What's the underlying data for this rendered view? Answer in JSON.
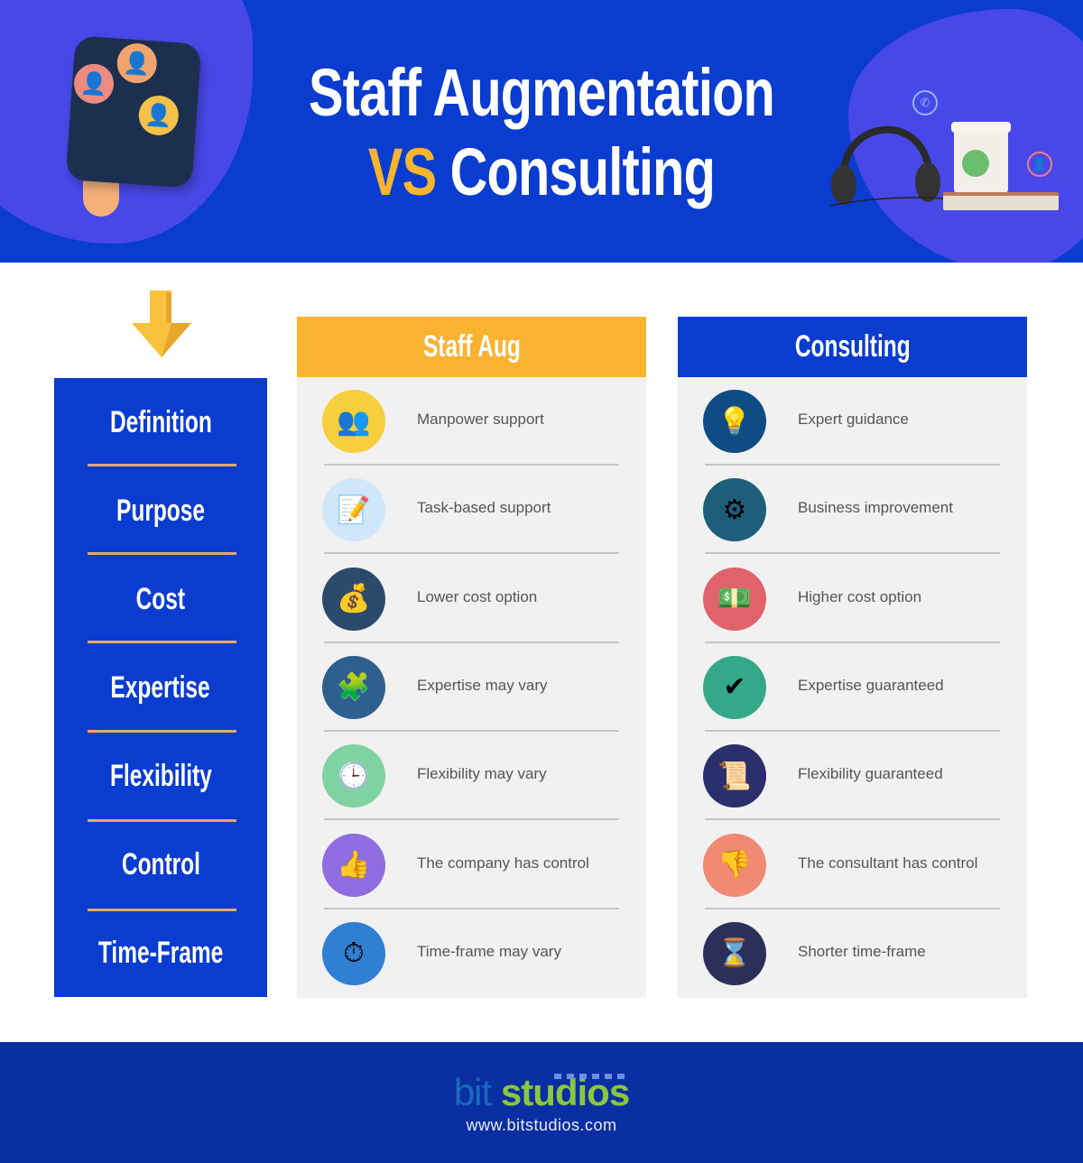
{
  "header": {
    "title_line1": "Staff Augmentation",
    "title_vs": "VS",
    "title_line2": "Consulting",
    "colors": {
      "background": "#0a3ccf",
      "blob": "#4848e8",
      "accent": "#f7b52e"
    }
  },
  "sidebar": {
    "items": [
      {
        "label": "Definition"
      },
      {
        "label": "Purpose"
      },
      {
        "label": "Cost"
      },
      {
        "label": "Expertise"
      },
      {
        "label": "Flexibility"
      },
      {
        "label": "Control"
      },
      {
        "label": "Time-Frame"
      }
    ]
  },
  "columns": [
    {
      "title": "Staff Aug",
      "color": "#f9b331",
      "rows": [
        {
          "icon": "team-people-icon",
          "glyph": "👥",
          "text": "Manpower support"
        },
        {
          "icon": "checklist-pencil-icon",
          "glyph": "📝",
          "text": "Task-based support"
        },
        {
          "icon": "coins-hand-icon",
          "glyph": "💰",
          "text": "Lower cost option"
        },
        {
          "icon": "head-puzzle-icon",
          "glyph": "🧩",
          "text": "Expertise may vary"
        },
        {
          "icon": "clock-icon",
          "glyph": "🕒",
          "text": "Flexibility may vary"
        },
        {
          "icon": "thumbs-up-icon",
          "glyph": "👍",
          "text": "The company has control"
        },
        {
          "icon": "pie-clock-icon",
          "glyph": "⏱",
          "text": "Time-frame may vary"
        }
      ]
    },
    {
      "title": "Consulting",
      "color": "#0a3ccf",
      "rows": [
        {
          "icon": "lightbulb-icon",
          "glyph": "💡",
          "text": "Expert guidance"
        },
        {
          "icon": "gears-icon",
          "glyph": "⚙",
          "text": "Business improvement"
        },
        {
          "icon": "money-hand-icon",
          "glyph": "💵",
          "text": "Higher cost option"
        },
        {
          "icon": "checkmark-icon",
          "glyph": "✔",
          "text": "Expertise guaranteed"
        },
        {
          "icon": "certificate-icon",
          "glyph": "📜",
          "text": "Flexibility guaranteed"
        },
        {
          "icon": "thumbs-down-icon",
          "glyph": "👎",
          "text": "The consultant has control"
        },
        {
          "icon": "hourglass-icon",
          "glyph": "⌛",
          "text": "Shorter time-frame"
        }
      ]
    }
  ],
  "footer": {
    "logo_bit": "bit",
    "logo_studios": "studios",
    "url": "www.bitstudios.com"
  }
}
